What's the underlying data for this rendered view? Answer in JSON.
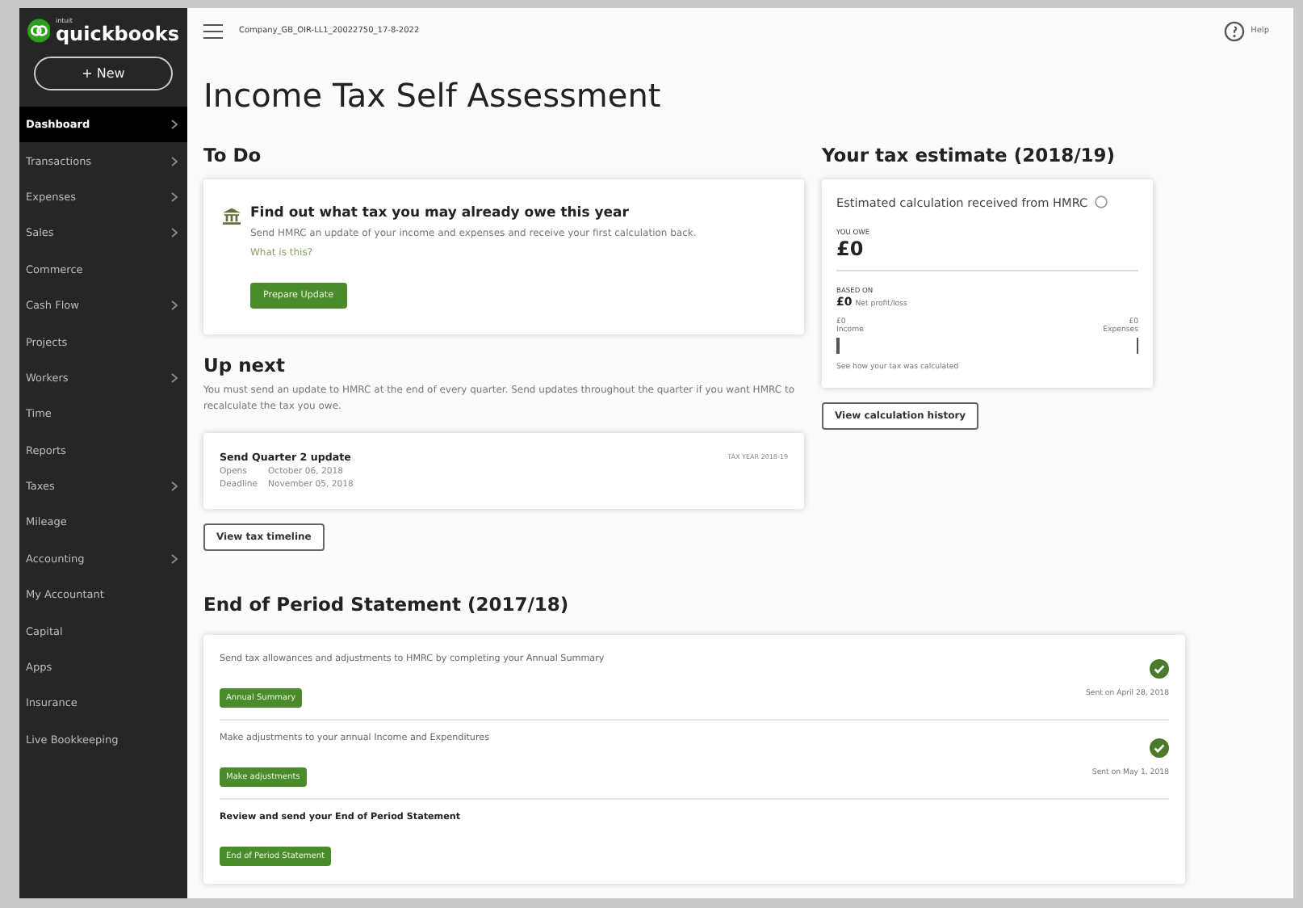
{
  "brand": {
    "small": "intuit",
    "name": "quickbooks"
  },
  "new_button": "+ New",
  "sidebar": {
    "items": [
      {
        "label": "Dashboard",
        "selected": true,
        "has_submenu": true
      },
      {
        "label": "Transactions",
        "selected": false,
        "has_submenu": true
      },
      {
        "label": "Expenses",
        "selected": false,
        "has_submenu": true
      },
      {
        "label": "Sales",
        "selected": false,
        "has_submenu": true
      },
      {
        "label": "Commerce",
        "selected": false,
        "has_submenu": false
      },
      {
        "label": "Cash Flow",
        "selected": false,
        "has_submenu": true
      },
      {
        "label": "Projects",
        "selected": false,
        "has_submenu": false
      },
      {
        "label": "Workers",
        "selected": false,
        "has_submenu": true
      },
      {
        "label": "Time",
        "selected": false,
        "has_submenu": false
      },
      {
        "label": "Reports",
        "selected": false,
        "has_submenu": false
      },
      {
        "label": "Taxes",
        "selected": false,
        "has_submenu": true
      },
      {
        "label": "Mileage",
        "selected": false,
        "has_submenu": false
      },
      {
        "label": "Accounting",
        "selected": false,
        "has_submenu": true
      },
      {
        "label": "My Accountant",
        "selected": false,
        "has_submenu": false
      },
      {
        "label": "Capital",
        "selected": false,
        "has_submenu": false
      },
      {
        "label": "Apps",
        "selected": false,
        "has_submenu": false
      },
      {
        "label": "Insurance",
        "selected": false,
        "has_submenu": false
      },
      {
        "label": "Live Bookkeeping",
        "selected": false,
        "has_submenu": false
      }
    ]
  },
  "header": {
    "company": "Company_GB_OIR-LL1_20022750_17-8-2022",
    "help": "Help"
  },
  "page_title": "Income Tax Self Assessment",
  "todo": {
    "heading": "To Do",
    "title": "Find out what tax you may already owe this year",
    "body": "Send HMRC an update of your income and expenses and receive your first calculation back.",
    "link": "What is this?",
    "button": "Prepare Update"
  },
  "up_next": {
    "heading": "Up next",
    "body": "You must send an update to HMRC at the end of every quarter. Send updates throughout the quarter if you want HMRC to recalculate the tax you owe.",
    "card": {
      "title": "Send Quarter 2 update",
      "tag": "TAX YEAR 2018-19",
      "rows": [
        {
          "label": "Opens",
          "value": "October 06, 2018"
        },
        {
          "label": "Deadline",
          "value": "November 05, 2018"
        }
      ]
    },
    "button": "View tax timeline"
  },
  "estimate": {
    "heading": "Your tax estimate (2018/19)",
    "card_title": "Estimated calculation received from HMRC",
    "owe_label": "YOU OWE",
    "owe_value": "£0",
    "based_label": "BASED ON",
    "based_value": "£0",
    "based_note": "Net profit/loss",
    "income_value": "£0",
    "income_label": "Income",
    "expenses_value": "£0",
    "expenses_label": "Expenses",
    "link": "See how your tax was calculated",
    "button": "View calculation history"
  },
  "eops": {
    "heading": "End of Period Statement (2017/18)",
    "items": [
      {
        "text": "Send tax allowances and adjustments to HMRC by completing your Annual Summary",
        "button": "Annual Summary",
        "done": true,
        "status": "Sent on April 28, 2018"
      },
      {
        "text": "Make adjustments to your annual Income and Expenditures",
        "button": "Make adjustments",
        "done": true,
        "status": "Sent on May 1, 2018"
      },
      {
        "text": "Review and send your End of Period Statement",
        "button": "End of Period Statement",
        "done": false
      }
    ]
  }
}
